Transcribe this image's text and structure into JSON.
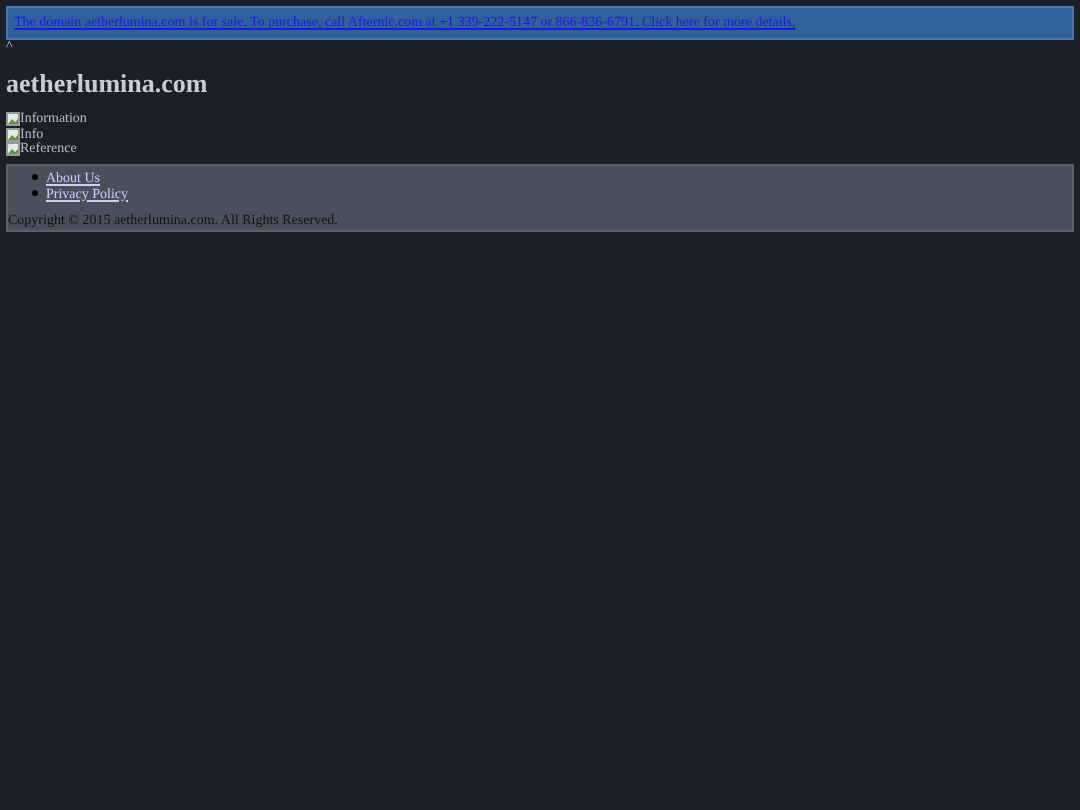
{
  "banner": {
    "text": "The domain aetherlumina.com is for sale. To purchase, call Afternic.com at +1 339-222-5147 or 866-836-6791. Click here for more details."
  },
  "caret": "^",
  "site_title": "aetherlumina.com",
  "images": [
    {
      "alt": "Information"
    },
    {
      "alt": "Info"
    },
    {
      "alt": "Reference"
    }
  ],
  "footer": {
    "links": [
      "About Us",
      "Privacy Policy"
    ],
    "copyright": "Copyright © 2015 aetherlumina.com. All Rights Reserved."
  }
}
